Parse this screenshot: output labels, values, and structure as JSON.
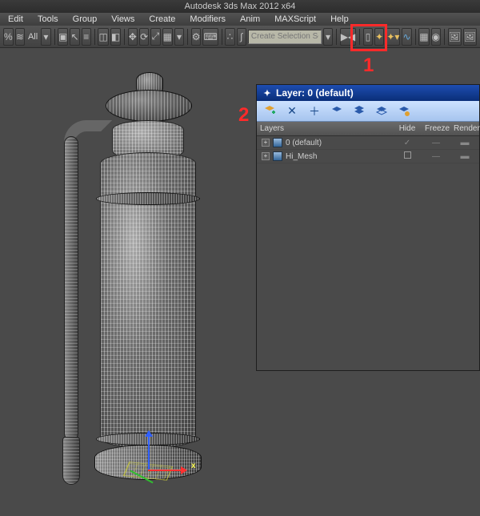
{
  "titlebar": {
    "title": "Autodesk 3ds Max 2012 x64"
  },
  "menu": {
    "items": [
      "Edit",
      "Tools",
      "Group",
      "Views",
      "Create",
      "Modifiers",
      "Anim",
      "MAXScript",
      "Help"
    ]
  },
  "toolbar": {
    "all_label": "All",
    "selection_set_placeholder": "Create Selection Se"
  },
  "annotations": {
    "one": "1",
    "two": "2"
  },
  "layer_panel": {
    "title": "Layer: 0 (default)",
    "columns": {
      "layers": "Layers",
      "hide": "Hide",
      "freeze": "Freeze",
      "render": "Render"
    },
    "rows": [
      {
        "name": "0 (default)",
        "hide": "check",
        "freeze": "—",
        "render": "on"
      },
      {
        "name": "Hi_Mesh",
        "hide": "box",
        "freeze": "—",
        "render": "on"
      }
    ]
  },
  "viewport": {
    "axis_x_label": "x"
  }
}
